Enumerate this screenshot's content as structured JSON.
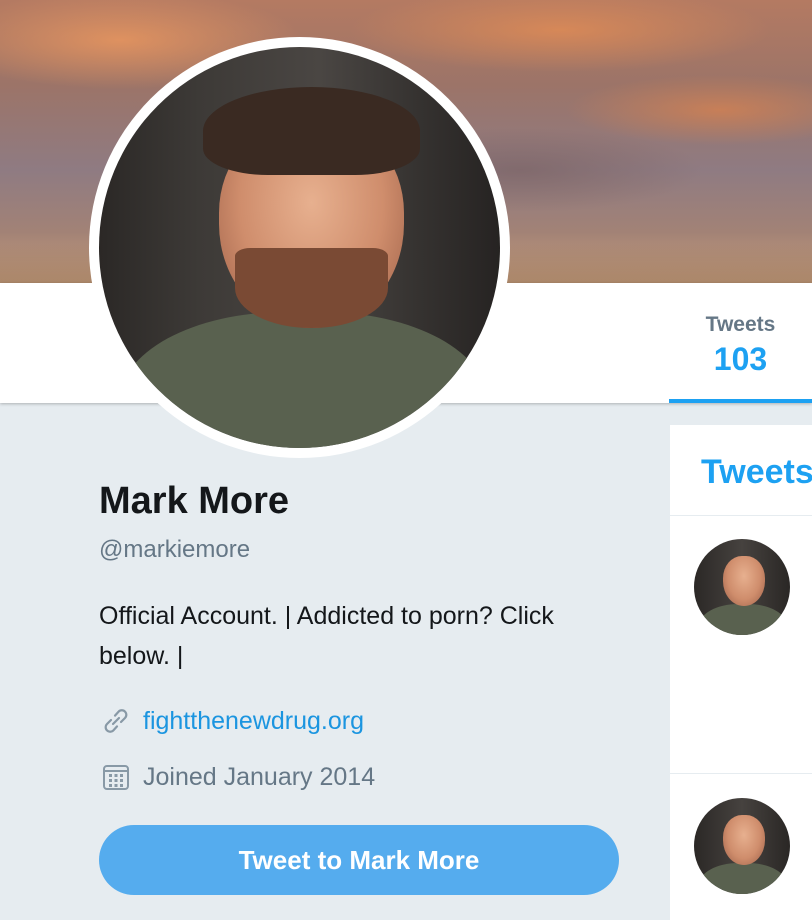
{
  "profile": {
    "name": "Mark More",
    "handle": "@markiemore",
    "bio": "Official Account. | Addicted to porn? Click below. |",
    "link": "fightthenewdrug.org",
    "joined": "Joined January 2014",
    "link_icon": "link-icon",
    "calendar_icon": "calendar-icon"
  },
  "nav": {
    "tabs": [
      {
        "label": "Tweets",
        "count": "103",
        "active": true
      }
    ]
  },
  "actions": {
    "tweet_to_label": "Tweet to Mark More"
  },
  "timeline": {
    "header": "Tweets"
  },
  "colors": {
    "accent": "#1da1f2",
    "link": "#1b95e0",
    "button": "#55acee",
    "background": "#e6ecf0",
    "secondary_text": "#657786"
  }
}
